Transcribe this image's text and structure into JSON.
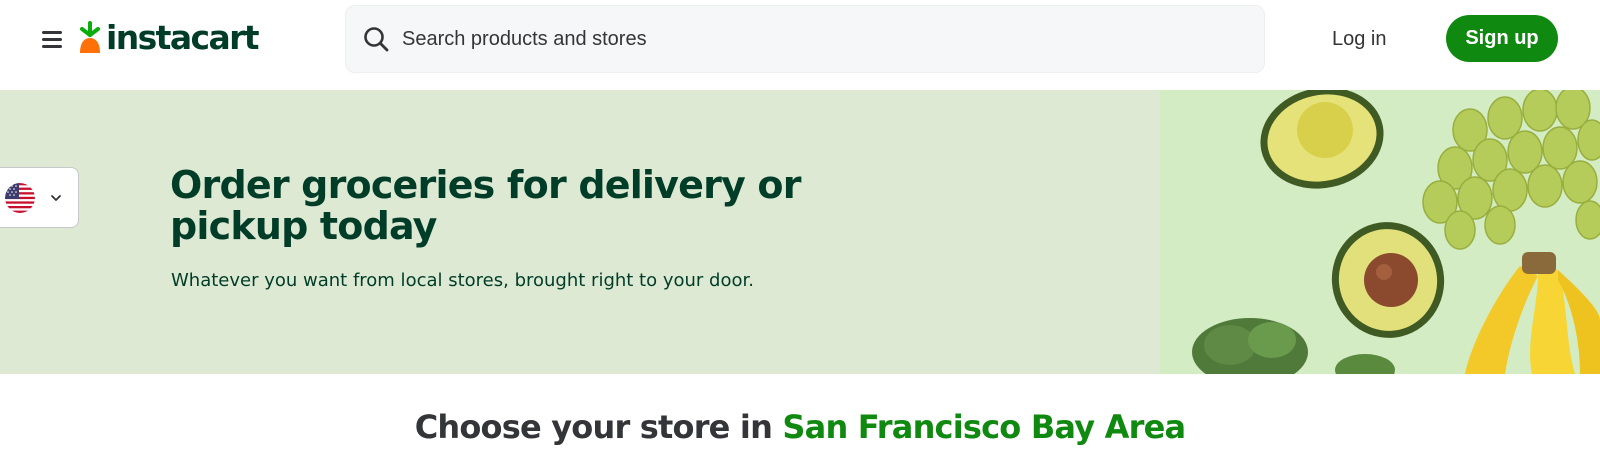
{
  "header": {
    "brand": "instacart",
    "search": {
      "placeholder": "Search products and stores",
      "value": ""
    },
    "login_label": "Log in",
    "signup_label": "Sign up",
    "icons": {
      "menu": "hamburger-menu-icon",
      "search": "search-icon",
      "logo": "carrot-logo-icon"
    }
  },
  "locale": {
    "country": "US",
    "flag_icon": "us-flag-icon",
    "chevron_icon": "chevron-down-icon"
  },
  "hero": {
    "title": "Order groceries for delivery or pickup today",
    "subtitle": "Whatever you want from local stores, brought right to your door.",
    "image": "groceries-produce-image"
  },
  "store_section": {
    "heading_prefix": "Choose your store in ",
    "location": "San Francisco Bay Area"
  },
  "colors": {
    "brand_green": "#108910",
    "dark_green": "#003d29",
    "hero_bg": "#dde9d3",
    "carrot_orange": "#ff7009"
  }
}
